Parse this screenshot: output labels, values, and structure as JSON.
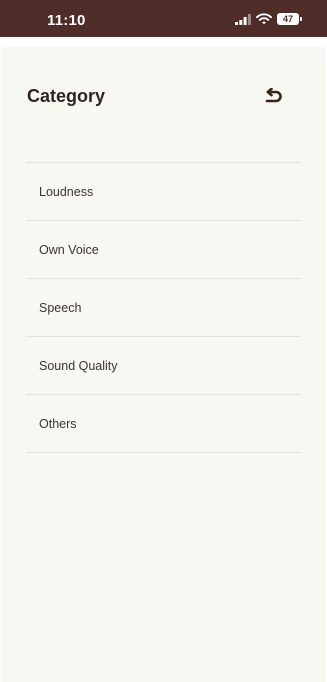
{
  "status_bar": {
    "time": "11:10",
    "battery_level": "47",
    "icons": [
      "cellular-signal-icon",
      "wifi-icon",
      "battery-icon"
    ]
  },
  "header": {
    "title": "Category",
    "back_icon": "return-arrow-icon"
  },
  "categories": [
    {
      "label": "Loudness"
    },
    {
      "label": "Own Voice"
    },
    {
      "label": "Speech"
    },
    {
      "label": "Sound Quality"
    },
    {
      "label": "Others"
    }
  ],
  "colors": {
    "status_bar_bg": "#4e2c27",
    "page_bg": "#f8f8f3",
    "divider": "#e3e1db",
    "text_primary": "#2b2624"
  }
}
